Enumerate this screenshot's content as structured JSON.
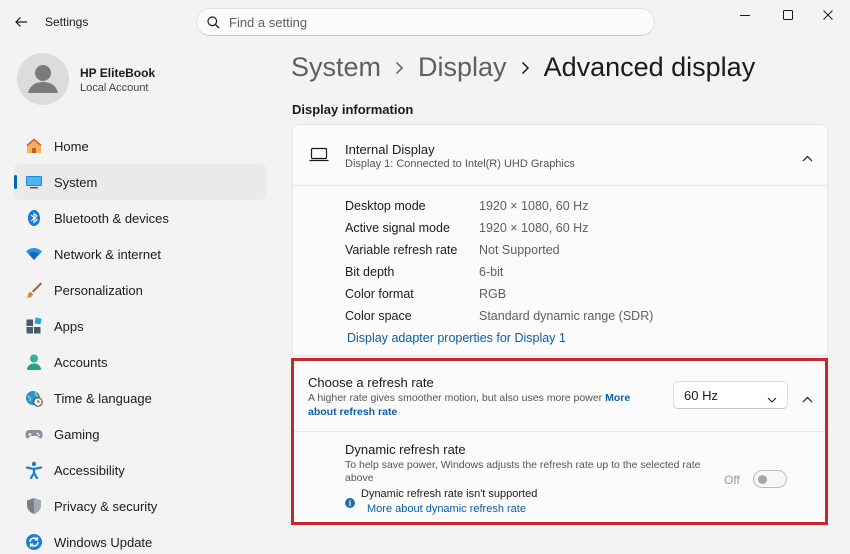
{
  "window": {
    "title": "Settings",
    "controls": {
      "minimize": "minimize-icon",
      "maximize": "maximize-icon",
      "close": "close-icon"
    }
  },
  "search": {
    "placeholder": "Find a setting",
    "value": ""
  },
  "profile": {
    "name": "HP EliteBook",
    "account_type": "Local Account"
  },
  "sidebar": {
    "items": [
      {
        "label": "Home",
        "icon": "home-icon",
        "active": false
      },
      {
        "label": "System",
        "icon": "system-icon",
        "active": true
      },
      {
        "label": "Bluetooth & devices",
        "icon": "bluetooth-icon",
        "active": false
      },
      {
        "label": "Network & internet",
        "icon": "wifi-icon",
        "active": false
      },
      {
        "label": "Personalization",
        "icon": "brush-icon",
        "active": false
      },
      {
        "label": "Apps",
        "icon": "apps-icon",
        "active": false
      },
      {
        "label": "Accounts",
        "icon": "accounts-icon",
        "active": false
      },
      {
        "label": "Time & language",
        "icon": "globe-clock-icon",
        "active": false
      },
      {
        "label": "Gaming",
        "icon": "gamepad-icon",
        "active": false
      },
      {
        "label": "Accessibility",
        "icon": "accessibility-icon",
        "active": false
      },
      {
        "label": "Privacy & security",
        "icon": "shield-icon",
        "active": false
      },
      {
        "label": "Windows Update",
        "icon": "update-icon",
        "active": false
      }
    ]
  },
  "breadcrumb": {
    "items": [
      "System",
      "Display",
      "Advanced display"
    ]
  },
  "section_title": "Display information",
  "display_card": {
    "name": "Internal Display",
    "subtitle": "Display 1: Connected to Intel(R) UHD Graphics",
    "specs": [
      {
        "label": "Desktop mode",
        "value": "1920 × 1080, 60 Hz"
      },
      {
        "label": "Active signal mode",
        "value": "1920 × 1080, 60 Hz"
      },
      {
        "label": "Variable refresh rate",
        "value": "Not Supported"
      },
      {
        "label": "Bit depth",
        "value": "6-bit"
      },
      {
        "label": "Color format",
        "value": "RGB"
      },
      {
        "label": "Color space",
        "value": "Standard dynamic range (SDR)"
      }
    ],
    "adapter_link": "Display adapter properties for Display 1"
  },
  "refresh_card": {
    "title": "Choose a refresh rate",
    "description": "A higher rate gives smoother motion, but also uses more power",
    "more_link": "More about refresh rate",
    "selected_rate": "60 Hz",
    "dynamic": {
      "title": "Dynamic refresh rate",
      "description": "To help save power, Windows adjusts the refresh rate up to the selected rate above",
      "toggle_state": "Off",
      "notice": "Dynamic refresh rate isn't supported",
      "notice_link": "More about dynamic refresh rate"
    }
  },
  "colors": {
    "accent": "#0067c0",
    "link": "#0b5ea8",
    "highlight_border": "#c4262e"
  }
}
